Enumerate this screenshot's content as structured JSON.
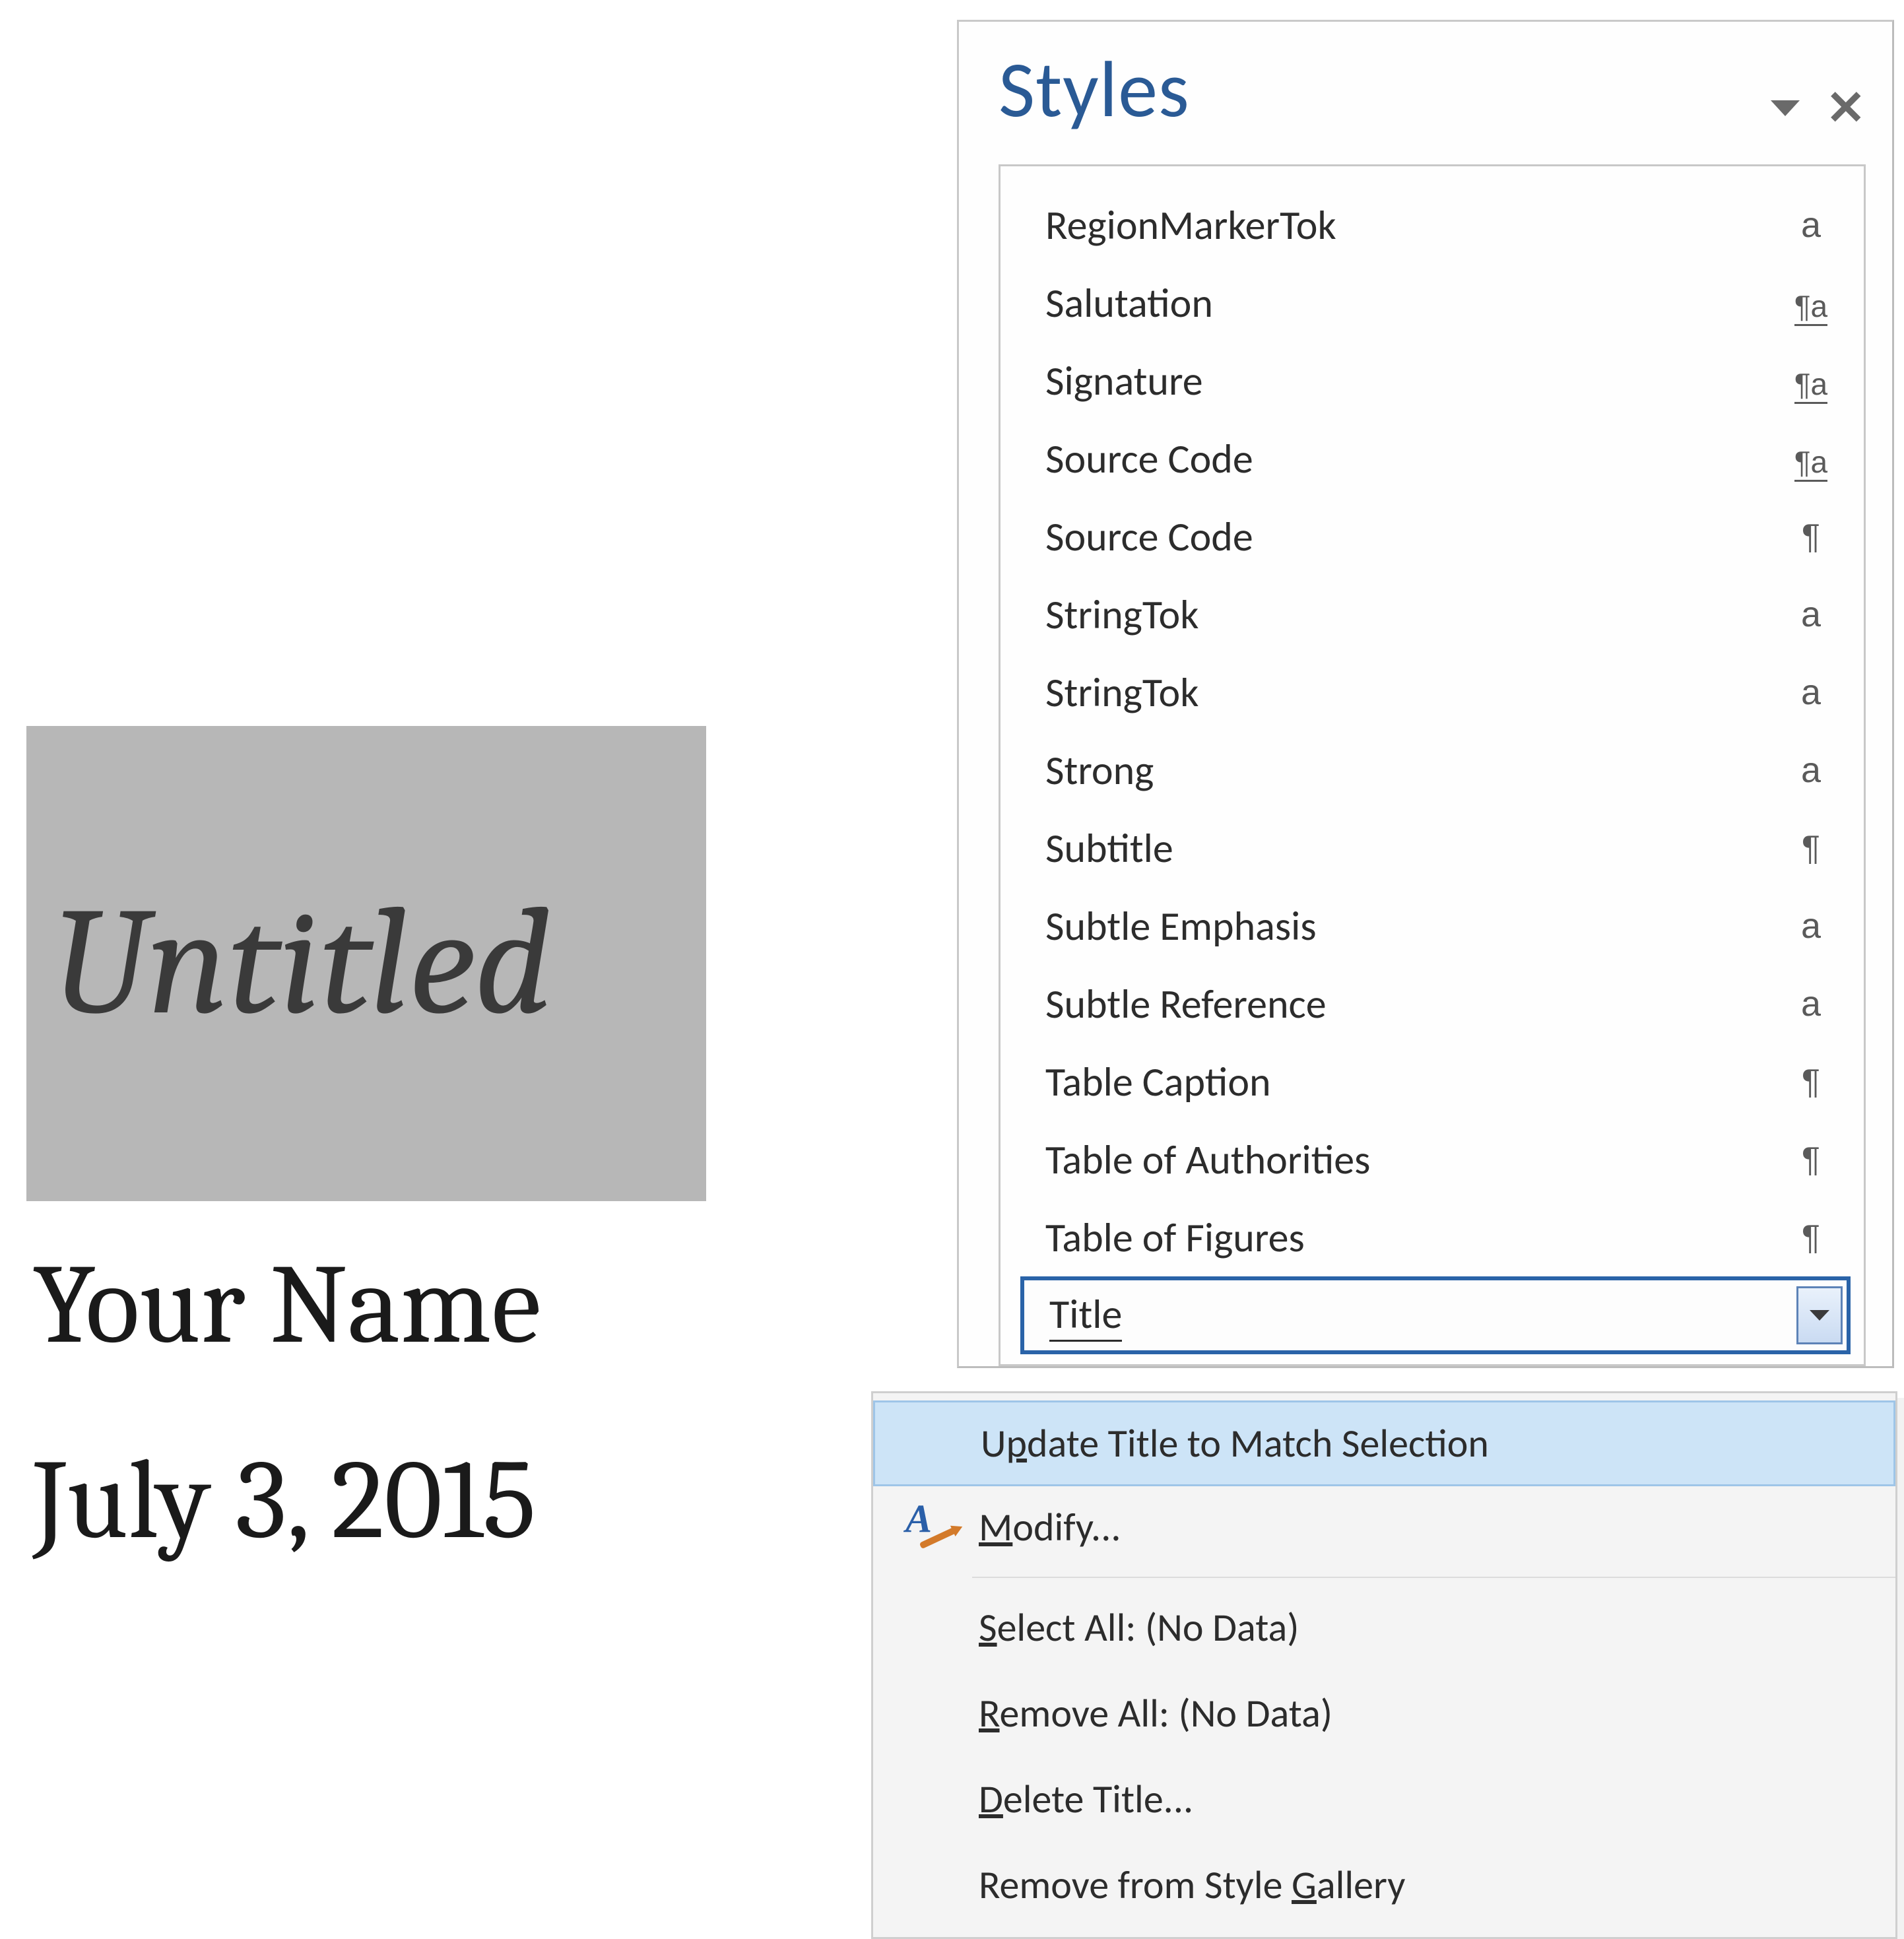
{
  "doc": {
    "title_text": "Untitled",
    "author_text": "Your Name",
    "date_text": "July 3, 2015"
  },
  "styles_pane": {
    "title": "Styles",
    "items": [
      {
        "label": "RegionMarkerTok",
        "type": "char"
      },
      {
        "label": "Salutation",
        "type": "linked"
      },
      {
        "label": "Signature",
        "type": "linked"
      },
      {
        "label": "Source Code",
        "type": "linked"
      },
      {
        "label": "Source Code",
        "type": "paragraph"
      },
      {
        "label": "StringTok",
        "type": "char"
      },
      {
        "label": "StringTok",
        "type": "char"
      },
      {
        "label": "Strong",
        "type": "char"
      },
      {
        "label": "Subtitle",
        "type": "paragraph"
      },
      {
        "label": "Subtle Emphasis",
        "type": "char"
      },
      {
        "label": "Subtle Reference",
        "type": "char"
      },
      {
        "label": "Table Caption",
        "type": "paragraph"
      },
      {
        "label": "Table of Authorities",
        "type": "paragraph"
      },
      {
        "label": "Table of Figures",
        "type": "paragraph"
      }
    ],
    "selected": {
      "label": "Title"
    }
  },
  "context_menu": {
    "items": [
      {
        "key": "update",
        "pre": "U",
        "ul": "p",
        "post": "date Title to Match Selection",
        "highlight": true,
        "icon": "none"
      },
      {
        "key": "modify",
        "pre": "",
        "ul": "M",
        "post": "odify...",
        "highlight": false,
        "icon": "modify"
      },
      {
        "key": "sep1",
        "separator": true
      },
      {
        "key": "selectall",
        "pre": "",
        "ul": "S",
        "post": "elect All: (No Data)",
        "highlight": false,
        "icon": "none"
      },
      {
        "key": "removeall",
        "pre": "",
        "ul": "R",
        "post": "emove All: (No Data)",
        "highlight": false,
        "icon": "none"
      },
      {
        "key": "delete",
        "pre": "",
        "ul": "D",
        "post": "elete Title...",
        "highlight": false,
        "icon": "none"
      },
      {
        "key": "removegal",
        "pre": "Remove from Style ",
        "ul": "G",
        "post": "allery",
        "highlight": false,
        "icon": "none"
      }
    ]
  }
}
